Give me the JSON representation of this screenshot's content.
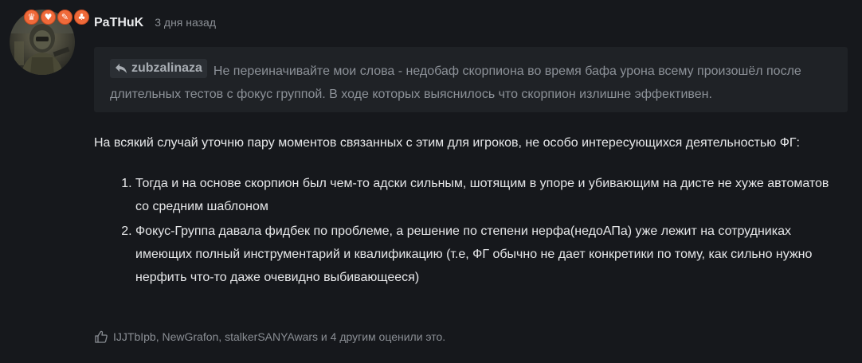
{
  "post": {
    "username": "PaTHuK",
    "timestamp": "3 дня назад",
    "badges": [
      {
        "icon": "trophy-icon",
        "glyph": "♛"
      },
      {
        "icon": "cup-icon",
        "glyph": "♥"
      },
      {
        "icon": "chat-icon",
        "glyph": "✎"
      },
      {
        "icon": "club-icon",
        "glyph": "♣"
      }
    ],
    "badge_color": "#ef6a3a",
    "quote": {
      "author": "zubzalinaza",
      "text": "Не переиначивайте мои слова - недобаф скорпиона во время бафа урона всему произошёл после длительных тестов с фокус группой. В ходе которых выяснилось что скорпион излишне эффективен."
    },
    "intro": "На всякий случай уточню пару моментов связанных с этим для игроков, не особо интересующихся деятельностью ФГ:",
    "list_items": [
      "Тогда и на основе скорпион был чем-то адски сильным, шотящим в упоре и убивающим на дисте не хуже автоматов со средним шаблоном",
      "Фокус-Группа давала фидбек по проблеме, а решение по степени нерфа(недоАПа) уже лежит на сотрудниках имеющих полный инструментарий и квалификацию (т.е, ФГ обычно не дает конкретики по тому, как сильно нужно нерфить что-то даже очевидно выбивающееся)"
    ],
    "likes": {
      "user1": "IJJTbIpb",
      "user2": "NewGrafon",
      "user3": "stalkerSANYAwars",
      "sep1": ", ",
      "sep2": ", ",
      "rest": " и 4 другим оценили это."
    }
  }
}
